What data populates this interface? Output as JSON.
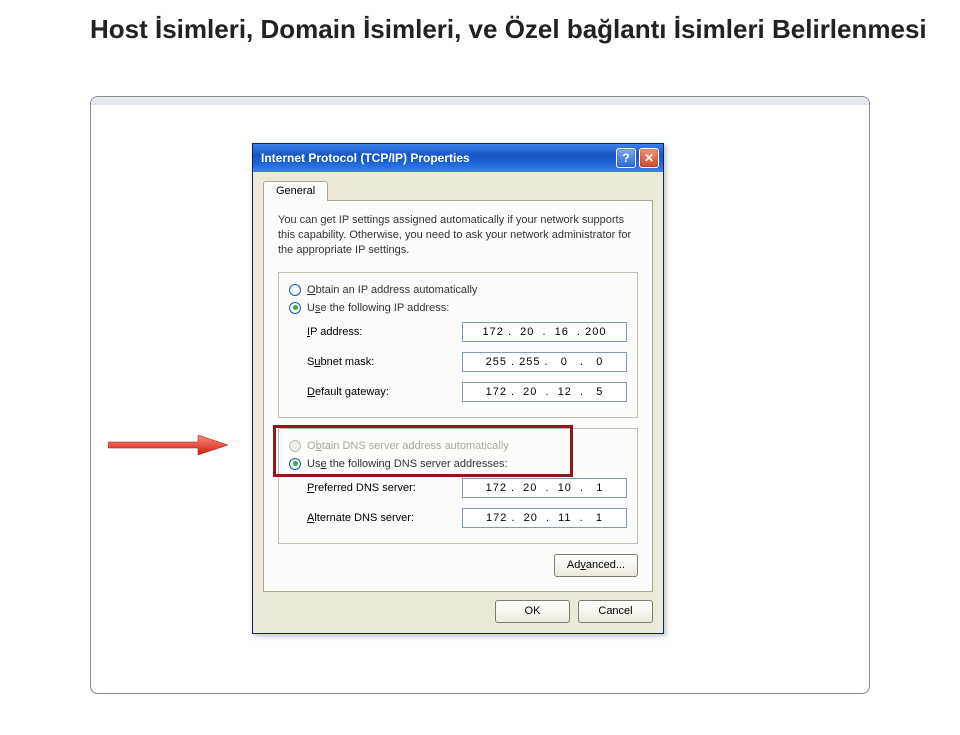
{
  "slide": {
    "title": "Host İsimleri, Domain İsimleri, ve Özel bağlantı İsimleri Belirlenmesi"
  },
  "dialog": {
    "title": "Internet Protocol (TCP/IP) Properties",
    "tab": "General",
    "description": "You can get IP settings assigned automatically if your network supports this capability. Otherwise, you need to ask your network administrator for the appropriate IP settings.",
    "ip_section": {
      "radio_auto": "Obtain an IP address automatically",
      "radio_auto_uchar": "O",
      "radio_auto_rest": "btain an IP address automatically",
      "radio_manual_pre": "U",
      "radio_manual_uchar": "s",
      "radio_manual_rest": "e the following IP address:",
      "ip_label_uchar": "I",
      "ip_label_rest": "P address:",
      "subnet_label_pre": "S",
      "subnet_label_uchar": "u",
      "subnet_label_rest": "bnet mask:",
      "gw_label_uchar": "D",
      "gw_label_rest": "efault gateway:",
      "ip_value": "172 .  20  .  16  . 200",
      "subnet_value": "255 . 255 .   0   .   0",
      "gw_value": "172 .  20  .  12  .   5"
    },
    "dns_section": {
      "radio_auto_pre": "O",
      "radio_auto_uchar": "b",
      "radio_auto_rest": "tain DNS server address automatically",
      "radio_manual_pre": "Us",
      "radio_manual_uchar": "e",
      "radio_manual_rest": " the following DNS server addresses:",
      "pref_label_uchar": "P",
      "pref_label_rest": "referred DNS server:",
      "alt_label_uchar": "A",
      "alt_label_rest": "lternate DNS server:",
      "pref_value": "172 .  20  .  10  .   1",
      "alt_value": "172 .  20  .  11  .   1"
    },
    "advanced_btn_pre": "Ad",
    "advanced_btn_uchar": "v",
    "advanced_btn_rest": "anced...",
    "ok": "OK",
    "cancel": "Cancel"
  }
}
